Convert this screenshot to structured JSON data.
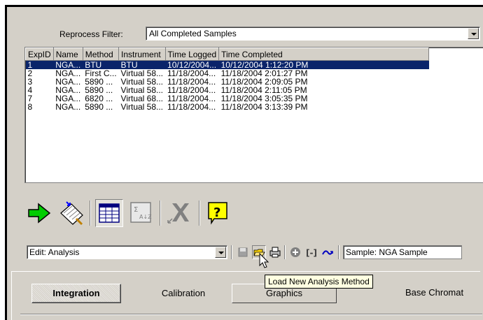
{
  "filter": {
    "label": "Reprocess Filter:",
    "value": "All Completed Samples"
  },
  "grid": {
    "columns": [
      "ExpID",
      "Name",
      "Method",
      "Instrument",
      "Time Logged",
      "Time Completed"
    ],
    "rows": [
      [
        "1",
        "NGA...",
        "BTU",
        "BTU",
        "10/12/2004...",
        "10/12/2004 1:12:20 PM"
      ],
      [
        "2",
        "NGA...",
        "First C...",
        "Virtual 58...",
        "11/18/2004...",
        "11/18/2004 2:01:27 PM"
      ],
      [
        "3",
        "NGA...",
        "5890 ...",
        "Virtual 58...",
        "11/18/2004...",
        "11/18/2004 2:09:05 PM"
      ],
      [
        "4",
        "NGA...",
        "5890 ...",
        "Virtual 58...",
        "11/18/2004...",
        "11/18/2004 2:11:05 PM"
      ],
      [
        "7",
        "NGA...",
        "6820 ...",
        "Virtual 68...",
        "11/18/2004...",
        "11/18/2004 3:05:35 PM"
      ],
      [
        "8",
        "NGA...",
        "5890 ...",
        "Virtual 58...",
        "11/18/2004...",
        "11/18/2004 3:13:39 PM"
      ]
    ],
    "selected_row": 0
  },
  "toolbar_icons": [
    "go-arrow-icon",
    "notepad-edit-icon",
    "table-view-icon",
    "sort-sigma-icon",
    "delete-x-icon",
    "help-question-icon"
  ],
  "edit": {
    "value": "Edit: Analysis"
  },
  "small_icons": [
    "save-icon",
    "open-folder-icon",
    "print-icon",
    "add-icon",
    "bracket-icon",
    "redo-icon"
  ],
  "sample": {
    "value": "Sample: NGA Sample"
  },
  "tabs": {
    "integration": "Integration",
    "calibration": "Calibration",
    "graphics": "Graphics",
    "base": "Base Chromat"
  },
  "tooltip": "Load New Analysis Method",
  "colors": {
    "selection": "#0a246a",
    "tooltip_bg": "#ffffe1",
    "face": "#d4d0c8"
  }
}
